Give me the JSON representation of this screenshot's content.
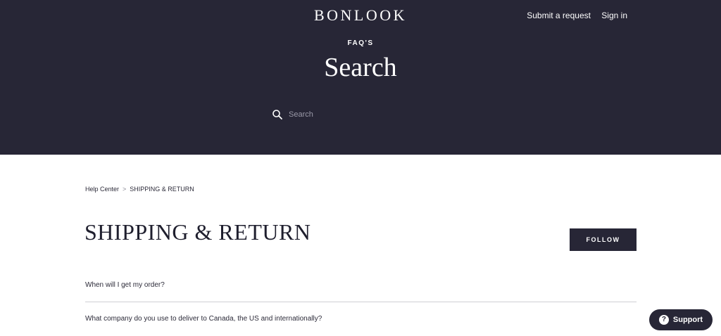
{
  "header": {
    "logo": "BONLOOK",
    "nav": {
      "submit_request": "Submit a request",
      "sign_in": "Sign in"
    },
    "eyebrow": "FAQ'S",
    "title": "Search",
    "search": {
      "placeholder": "Search",
      "icon": "search-icon"
    }
  },
  "breadcrumb": {
    "items": [
      "Help Center",
      "SHIPPING & RETURN"
    ],
    "separator": ">"
  },
  "section": {
    "title": "SHIPPING & RETURN",
    "follow_label": "FOLLOW",
    "articles": [
      "When will I get my order?",
      "What company do you use to deliver to Canada, the US and internationally?"
    ]
  },
  "support": {
    "label": "Support",
    "icon": "question-icon",
    "icon_glyph": "?"
  },
  "colors": {
    "hero_bg": "#272636",
    "button_bg": "#272636",
    "divider": "#cfcfd4"
  }
}
